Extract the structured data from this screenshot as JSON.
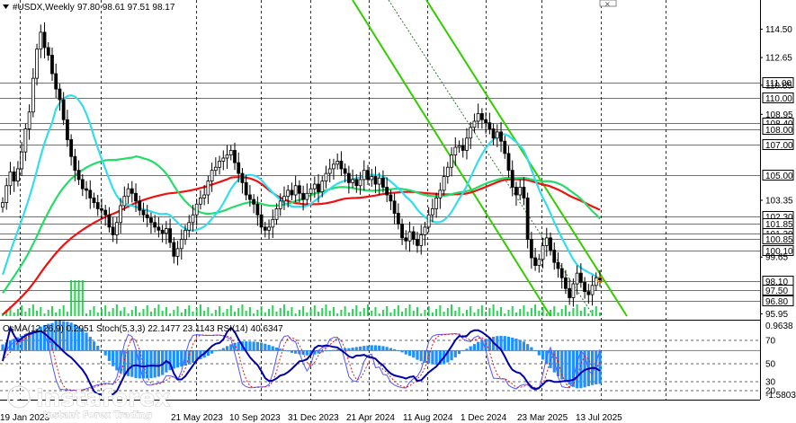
{
  "header": {
    "symbol": "#USDX,Weekly",
    "ohlc": "97.80 98.61 97.51 98.17",
    "indicators": "OsMA(12,26,9) 0.2951  Stoch(5,3,3) 22.1477 23.1143  RSI(14) 40.6347"
  },
  "watermark": {
    "brand": "instaforex",
    "tagline": "Instant Forex Trading"
  },
  "colors": {
    "candle": "#000000",
    "ma_fast": "#33ddee",
    "ma_mid": "#22dd66",
    "ma_slow": "#ee1111",
    "channel": "#33cc00",
    "osma": "#1e90ff",
    "stoch_main": "#5555ff",
    "stoch_signal": "#ee1111",
    "rsi": "#0000aa",
    "level_line": "#000000"
  },
  "chart_data": [
    {
      "type": "candlestick",
      "ylim": [
        95.8,
        116.4
      ],
      "x_tick_labels": [
        "19 Jan 2023",
        "21 May 2023",
        "10 Sep 2023",
        "31 Dec 2023",
        "21 Apr 2024",
        "11 Aug 2024",
        "1 Dec 2024",
        "23 Mar 2025",
        "13 Jul 2025"
      ],
      "y_tick_labels": [
        114.5,
        112.65,
        110.85,
        108.95,
        103.35,
        99.65,
        95.95
      ],
      "price_levels": [
        111.0,
        110.0,
        108.4,
        108.0,
        107.0,
        105.0,
        102.3,
        101.85,
        101.2,
        100.85,
        100.1,
        98.1,
        97.5,
        96.8
      ],
      "current_price": 98.17,
      "close": [
        103.2,
        104.3,
        105.2,
        104.6,
        105.4,
        106.5,
        108.0,
        109.1,
        111.3,
        113.2,
        114.3,
        113.3,
        112.8,
        111.6,
        110.6,
        109.9,
        108.6,
        107.3,
        106.2,
        105.3,
        104.7,
        104.1,
        104.0,
        103.5,
        103.2,
        102.8,
        102.7,
        102.4,
        101.6,
        101.1,
        101.9,
        103.0,
        103.6,
        104.1,
        103.8,
        103.3,
        102.7,
        102.4,
        102.2,
        101.9,
        101.6,
        101.4,
        101.2,
        101.5,
        100.6,
        99.7,
        100.2,
        100.8,
        101.4,
        101.9,
        102.4,
        103.1,
        103.5,
        103.7,
        104.6,
        105.3,
        105.5,
        105.9,
        106.1,
        106.3,
        106.6,
        105.8,
        105.1,
        104.5,
        103.7,
        103.4,
        103.1,
        102.4,
        101.6,
        101.4,
        101.6,
        102.1,
        102.8,
        103.3,
        103.6,
        104.0,
        103.7,
        104.3,
        103.8,
        103.4,
        103.8,
        104.1,
        104.4,
        103.9,
        104.6,
        105.1,
        105.4,
        105.7,
        105.9,
        105.4,
        105.1,
        104.5,
        104.7,
        104.3,
        104.7,
        105.3,
        104.7,
        104.9,
        104.4,
        104.8,
        104.2,
        103.7,
        103.3,
        102.5,
        101.8,
        100.9,
        100.7,
        101.3,
        100.8,
        100.4,
        101.1,
        101.6,
        102.4,
        102.8,
        103.5,
        104.0,
        104.9,
        105.5,
        106.3,
        106.8,
        106.9,
        106.6,
        107.4,
        108.1,
        108.5,
        109.0,
        108.6,
        108.4,
        108.0,
        107.4,
        107.8,
        107.2,
        106.4,
        105.3,
        104.2,
        103.7,
        104.2,
        103.5,
        100.8,
        99.6,
        99.1,
        99.5,
        100.4,
        100.9,
        100.1,
        99.3,
        98.9,
        98.3,
        97.6,
        97.0,
        97.9,
        98.6,
        98.0,
        97.4,
        97.2,
        97.8,
        98.3,
        98.17
      ]
    },
    {
      "type": "histogram",
      "series_name": "OsMA(12,26,9)",
      "current_value": 0.2951,
      "ylim": [
        -1.5803,
        0.9638
      ],
      "y_tick_labels": [
        0.9638,
        -1.5803
      ]
    },
    {
      "type": "line",
      "series": [
        {
          "name": "Stoch(5,3,3)",
          "values": [
            22.1477,
            23.1143
          ]
        },
        {
          "name": "RSI(14)",
          "values": [
            40.6347
          ]
        }
      ],
      "level_labels": [
        70,
        50,
        30,
        20
      ]
    }
  ]
}
